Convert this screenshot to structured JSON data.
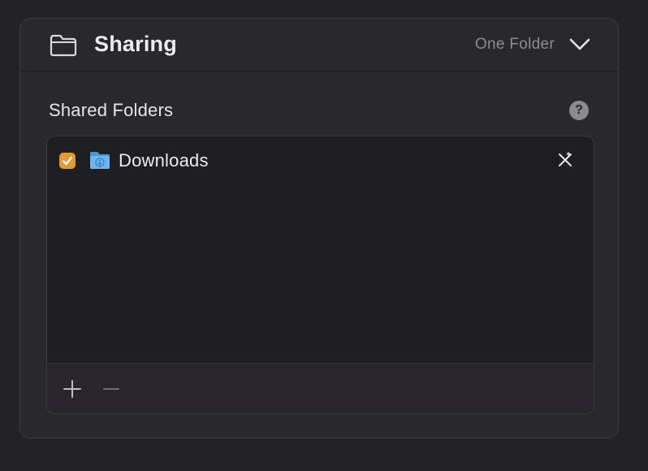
{
  "header": {
    "title": "Sharing",
    "summary": "One Folder",
    "folder_icon": "folder-outline-icon",
    "chevron_icon": "chevron-down-icon"
  },
  "section": {
    "title": "Shared Folders",
    "help_label": "?"
  },
  "folders": [
    {
      "name": "Downloads",
      "checked": true,
      "icon": "downloads-folder-icon",
      "action_icon": "remove-icon"
    }
  ],
  "footer": {
    "add_icon": "plus-icon",
    "remove_icon": "minus-icon"
  },
  "colors": {
    "accent_checkbox": "#e39a34",
    "folder_blue": "#5aa9e6",
    "background": "#222227",
    "panel": "#28282d"
  }
}
